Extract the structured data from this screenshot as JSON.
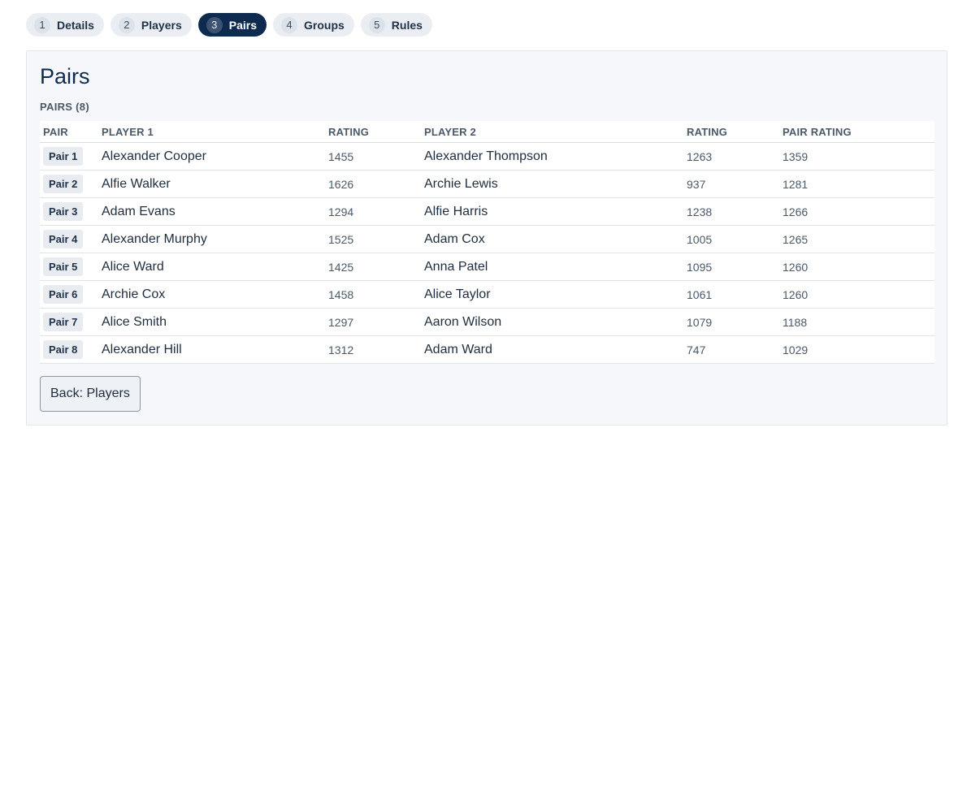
{
  "steps": [
    {
      "num": "1",
      "label": "Details"
    },
    {
      "num": "2",
      "label": "Players"
    },
    {
      "num": "3",
      "label": "Pairs",
      "active": true
    },
    {
      "num": "4",
      "label": "Groups"
    },
    {
      "num": "5",
      "label": "Rules"
    }
  ],
  "panel": {
    "title": "Pairs",
    "section_label": "PAIRS (8)",
    "columns": [
      "PAIR",
      "PLAYER 1",
      "RATING",
      "PLAYER 2",
      "RATING",
      "PAIR RATING"
    ],
    "rows": [
      {
        "pair": "Pair 1",
        "player1": "Alexander Cooper",
        "rating1": "1455",
        "player2": "Alexander Thompson",
        "rating2": "1263",
        "pair_rating": "1359"
      },
      {
        "pair": "Pair 2",
        "player1": "Alfie Walker",
        "rating1": "1626",
        "player2": "Archie Lewis",
        "rating2": "937",
        "pair_rating": "1281"
      },
      {
        "pair": "Pair 3",
        "player1": "Adam Evans",
        "rating1": "1294",
        "player2": "Alfie Harris",
        "rating2": "1238",
        "pair_rating": "1266"
      },
      {
        "pair": "Pair 4",
        "player1": "Alexander Murphy",
        "rating1": "1525",
        "player2": "Adam Cox",
        "rating2": "1005",
        "pair_rating": "1265"
      },
      {
        "pair": "Pair 5",
        "player1": "Alice Ward",
        "rating1": "1425",
        "player2": "Anna Patel",
        "rating2": "1095",
        "pair_rating": "1260"
      },
      {
        "pair": "Pair 6",
        "player1": "Archie Cox",
        "rating1": "1458",
        "player2": "Alice Taylor",
        "rating2": "1061",
        "pair_rating": "1260"
      },
      {
        "pair": "Pair 7",
        "player1": "Alice Smith",
        "rating1": "1297",
        "player2": "Aaron Wilson",
        "rating2": "1079",
        "pair_rating": "1188"
      },
      {
        "pair": "Pair 8",
        "player1": "Alexander Hill",
        "rating1": "1312",
        "player2": "Adam Ward",
        "rating2": "747",
        "pair_rating": "1029"
      }
    ],
    "back_button": "Back: Players"
  }
}
